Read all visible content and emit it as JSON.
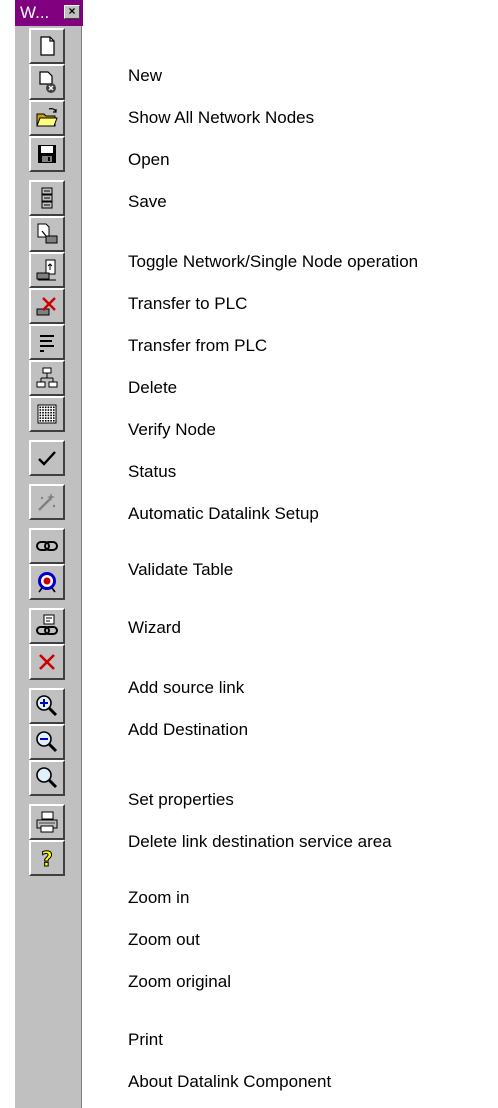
{
  "window": {
    "title": "W...",
    "close_glyph": "×"
  },
  "tools": [
    {
      "label": "New",
      "icon": "new-document-icon"
    },
    {
      "label": "Show All Network Nodes",
      "icon": "show-nodes-icon"
    },
    {
      "label": "Open",
      "icon": "open-folder-icon"
    },
    {
      "label": "Save",
      "icon": "save-disk-icon"
    },
    {
      "label": "Toggle Network/Single Node operation",
      "icon": "toggle-network-icon"
    },
    {
      "label": "Transfer to PLC",
      "icon": "transfer-to-plc-icon"
    },
    {
      "label": "Transfer from PLC",
      "icon": "transfer-from-plc-icon"
    },
    {
      "label": "Delete",
      "icon": "delete-icon"
    },
    {
      "label": "Verify Node",
      "icon": "verify-node-icon"
    },
    {
      "label": "Status",
      "icon": "status-icon"
    },
    {
      "label": "Automatic Datalink Setup",
      "icon": "datalink-grid-icon"
    },
    {
      "label": "Validate Table",
      "icon": "checkmark-icon"
    },
    {
      "label": "Wizard",
      "icon": "wizard-wand-icon"
    },
    {
      "label": "Add source link",
      "icon": "chain-link-icon"
    },
    {
      "label": "Add Destination",
      "icon": "target-icon"
    },
    {
      "label": "Set properties",
      "icon": "link-properties-icon"
    },
    {
      "label": "Delete link destination service area",
      "icon": "red-x-icon"
    },
    {
      "label": "Zoom in",
      "icon": "zoom-in-icon"
    },
    {
      "label": "Zoom out",
      "icon": "zoom-out-icon"
    },
    {
      "label": "Zoom original",
      "icon": "zoom-original-icon"
    },
    {
      "label": "Print",
      "icon": "printer-icon"
    },
    {
      "label": "About Datalink Component",
      "icon": "help-question-icon"
    }
  ]
}
